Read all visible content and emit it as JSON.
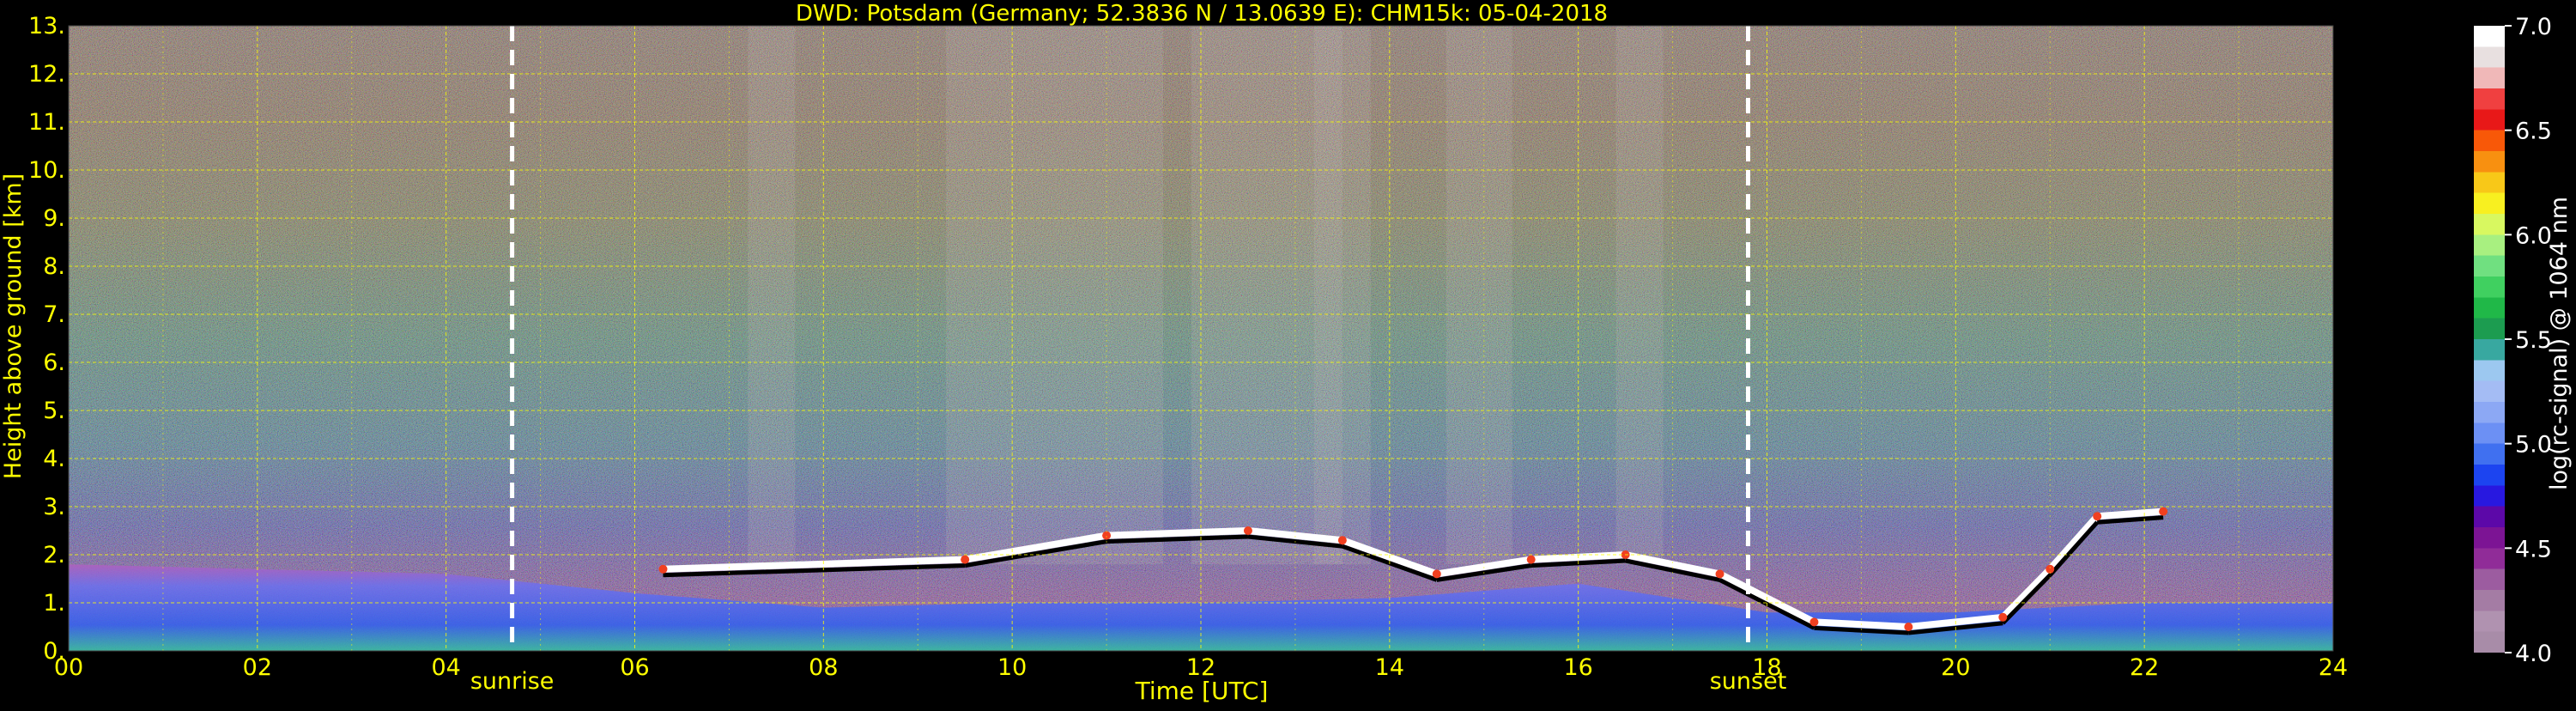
{
  "chart_data": {
    "type": "heatmap",
    "title": "DWD: Potsdam (Germany; 52.3836 N / 13.0639 E):    CHM15k: 05-04-2018",
    "xlabel": "Time [UTC]",
    "ylabel": "Height above ground [km]",
    "xlim": [
      0,
      24
    ],
    "ylim": [
      0,
      13
    ],
    "x_ticks": [
      "00",
      "02",
      "04",
      "06",
      "08",
      "10",
      "12",
      "14",
      "16",
      "18",
      "20",
      "22",
      "24"
    ],
    "y_ticks": [
      "0.",
      "1.",
      "2.",
      "3.",
      "4.",
      "5.",
      "6.",
      "7.",
      "8.",
      "9.",
      "10.",
      "11.",
      "12.",
      "13."
    ],
    "grid": true,
    "annotations": [
      {
        "label": "sunrise",
        "x": 4.7
      },
      {
        "label": "sunset",
        "x": 17.8
      }
    ],
    "colorbar": {
      "label": "log(rc-signal) @ 1064 nm",
      "range": [
        4.0,
        7.0
      ],
      "ticks": [
        "4.0",
        "4.5",
        "5.0",
        "5.5",
        "6.0",
        "6.5",
        "7.0"
      ],
      "colors": [
        "#a88ca8",
        "#b092b0",
        "#a47ca4",
        "#9c5ca0",
        "#902c98",
        "#7c1494",
        "#5c08a8",
        "#2818e0",
        "#1c44f0",
        "#4070f0",
        "#6c90f4",
        "#8ca8f4",
        "#a4bcf4",
        "#9cc8f0",
        "#38a8a0",
        "#1c9c50",
        "#20b848",
        "#40d060",
        "#70e080",
        "#a8f080",
        "#d8f860",
        "#f8f020",
        "#f8c818",
        "#f89010",
        "#f85808",
        "#e81818",
        "#f04040",
        "#f0b8b8",
        "#e8e0e0",
        "#ffffff"
      ]
    },
    "cloud_base_km_by_hour": [
      {
        "x": 6.3,
        "y": 1.7
      },
      {
        "x": 9.5,
        "y": 1.9
      },
      {
        "x": 11.0,
        "y": 2.4
      },
      {
        "x": 12.5,
        "y": 2.5
      },
      {
        "x": 13.5,
        "y": 2.3
      },
      {
        "x": 14.5,
        "y": 1.6
      },
      {
        "x": 15.5,
        "y": 1.9
      },
      {
        "x": 16.5,
        "y": 2.0
      },
      {
        "x": 17.5,
        "y": 1.6
      },
      {
        "x": 18.5,
        "y": 0.6
      },
      {
        "x": 19.5,
        "y": 0.5
      },
      {
        "x": 20.5,
        "y": 0.7
      },
      {
        "x": 21.0,
        "y": 1.7
      },
      {
        "x": 21.5,
        "y": 2.8
      },
      {
        "x": 22.2,
        "y": 2.9
      }
    ],
    "boundary_layer_top_km": [
      {
        "x": 0,
        "y": 1.8
      },
      {
        "x": 2,
        "y": 1.7
      },
      {
        "x": 4,
        "y": 1.6
      },
      {
        "x": 6,
        "y": 1.2
      },
      {
        "x": 8,
        "y": 0.9
      },
      {
        "x": 10,
        "y": 1.0
      },
      {
        "x": 12,
        "y": 1.0
      },
      {
        "x": 14,
        "y": 1.1
      },
      {
        "x": 16,
        "y": 1.4
      },
      {
        "x": 18,
        "y": 0.8
      },
      {
        "x": 20,
        "y": 0.8
      },
      {
        "x": 22,
        "y": 1.0
      },
      {
        "x": 24,
        "y": 1.0
      }
    ]
  }
}
